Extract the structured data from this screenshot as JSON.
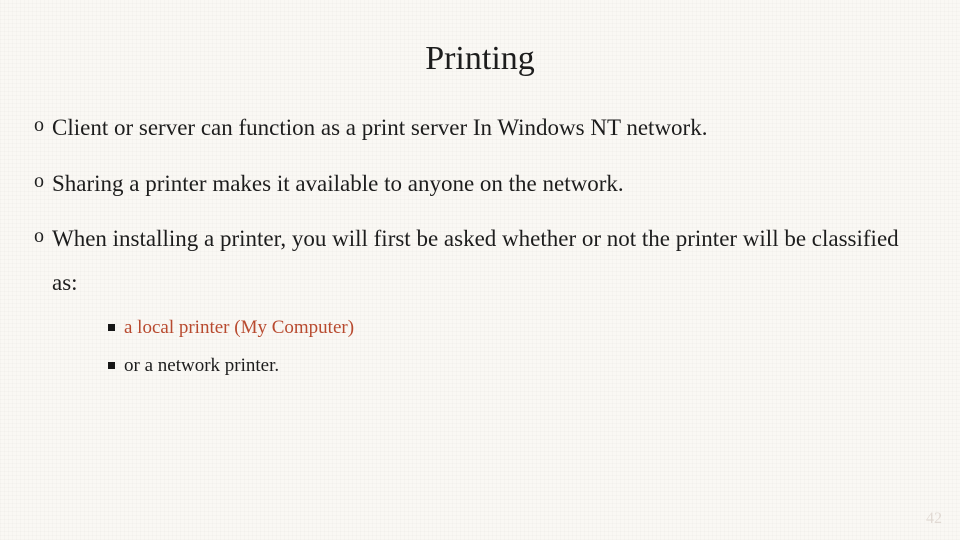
{
  "title": "Printing",
  "bullets": [
    {
      "text": "Client or server can function as a print server In Windows NT network."
    },
    {
      "text": "Sharing a printer makes it available to anyone on the network."
    },
    {
      "text": "When installing a printer, you will first be asked whether or not the printer will be classified as:"
    }
  ],
  "subbullets": [
    {
      "text": "a local printer (My Computer)",
      "accent": true
    },
    {
      "text": "or a network printer.",
      "accent": false
    }
  ],
  "page_number": "42"
}
